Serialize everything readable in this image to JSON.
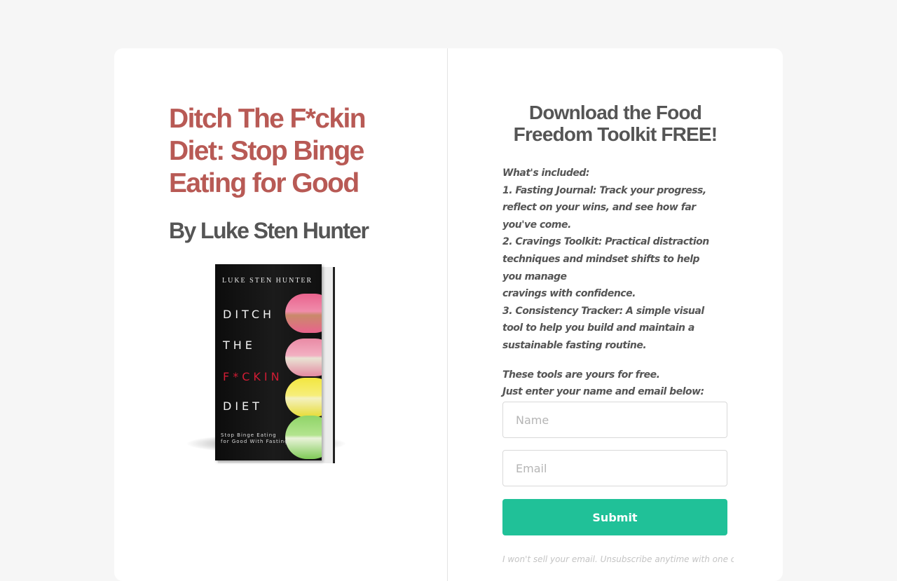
{
  "left_panel": {
    "title": "Ditch The F*ckin Diet: Stop Binge Eating for Good",
    "author_line": "By Luke Sten Hunter",
    "book_cover": {
      "author": "LUKE STEN HUNTER",
      "line1": "DITCH",
      "line2": "THE",
      "line3": "F*CKIN",
      "line4": "DIET",
      "subtitle": "Stop Binge Eating\nfor Good With Fasting",
      "accent_color": "#d11c34"
    }
  },
  "right_panel": {
    "title": "Download the Food Freedom Toolkit FREE!",
    "description_lines": [
      "What's included:",
      "1. Fasting Journal: Track your progress, reflect on your wins, and see how far you've come.",
      "2. Cravings Toolkit: Practical distraction techniques and mindset shifts to help you manage",
      "cravings with confidence.",
      "3. Consistency Tracker: A simple visual tool to help you build and maintain a sustainable fasting routine."
    ],
    "closing_lines": [
      "These tools are yours for free.",
      "Just enter your name and email below:"
    ],
    "form": {
      "name_placeholder": "Name",
      "email_placeholder": "Email",
      "submit_label": "Submit"
    },
    "footnote": "I won't sell your email. Unsubscribe anytime with one click."
  },
  "colors": {
    "page_background": "#f6f6f6",
    "card_background": "#ffffff",
    "title_color": "#b85a55",
    "heading_color": "#555555",
    "button_color": "#20c198"
  }
}
